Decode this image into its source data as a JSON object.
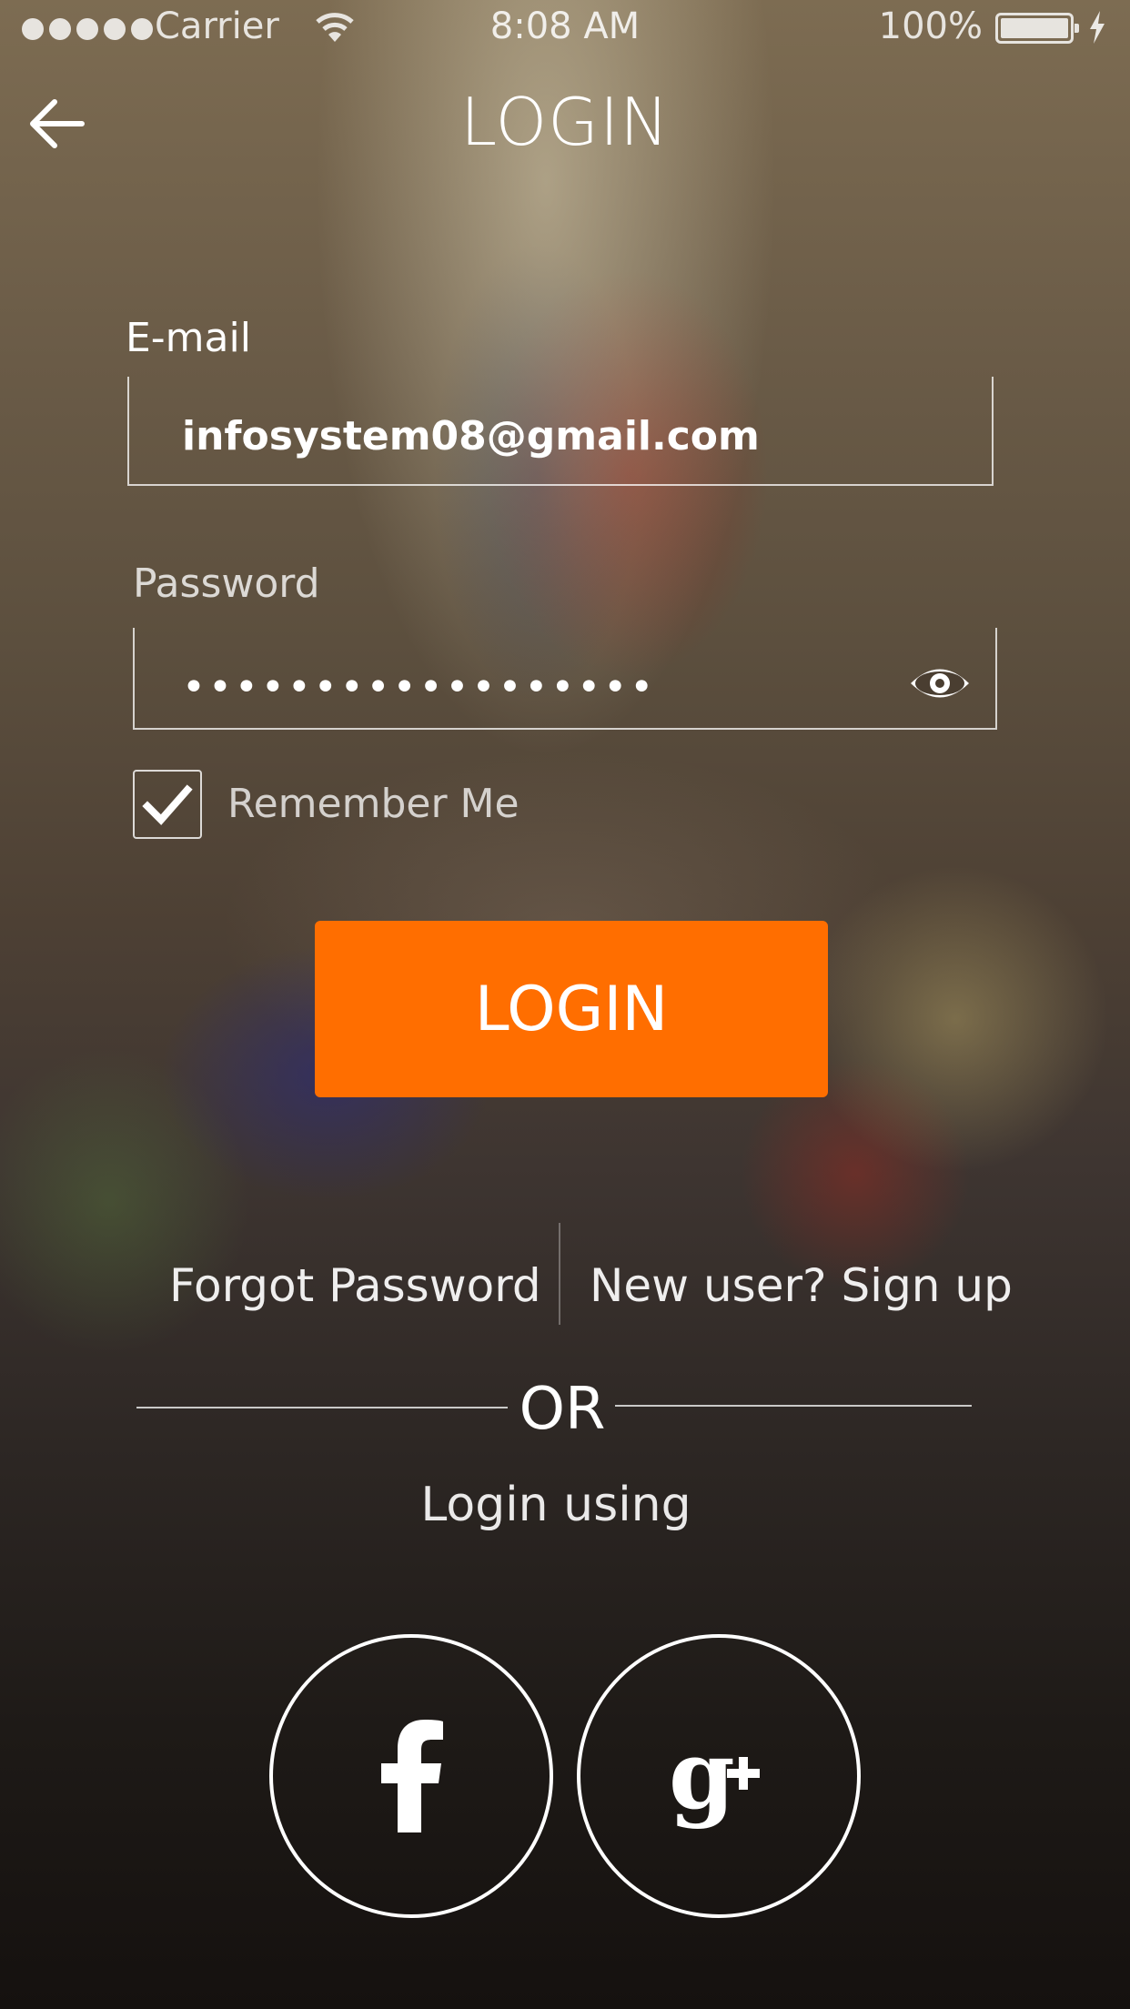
{
  "status_bar": {
    "carrier": "Carrier",
    "time": "8:08 AM",
    "battery": "100%",
    "signal_icon": "signal-dots-icon",
    "wifi_icon": "wifi-icon",
    "battery_icon": "battery-icon",
    "charging_icon": "bolt-icon"
  },
  "header": {
    "back_icon": "arrow-left-icon",
    "title": "LOGIN"
  },
  "form": {
    "email_label": "E-mail",
    "email_value": "infosystem08@gmail.com",
    "password_label": "Password",
    "password_value": "••••••••••••••••••",
    "password_toggle_icon": "eye-icon",
    "remember_label": "Remember Me",
    "remember_checked": true
  },
  "actions": {
    "login_label": "LOGIN",
    "login_color": "#ff6e00",
    "forgot_label": "Forgot Password",
    "signup_label": "New user? Sign up"
  },
  "social": {
    "or_label": "OR",
    "login_using_label": "Login using",
    "providers": [
      {
        "name": "facebook",
        "icon": "facebook-icon"
      },
      {
        "name": "google-plus",
        "icon": "google-plus-icon"
      }
    ]
  }
}
